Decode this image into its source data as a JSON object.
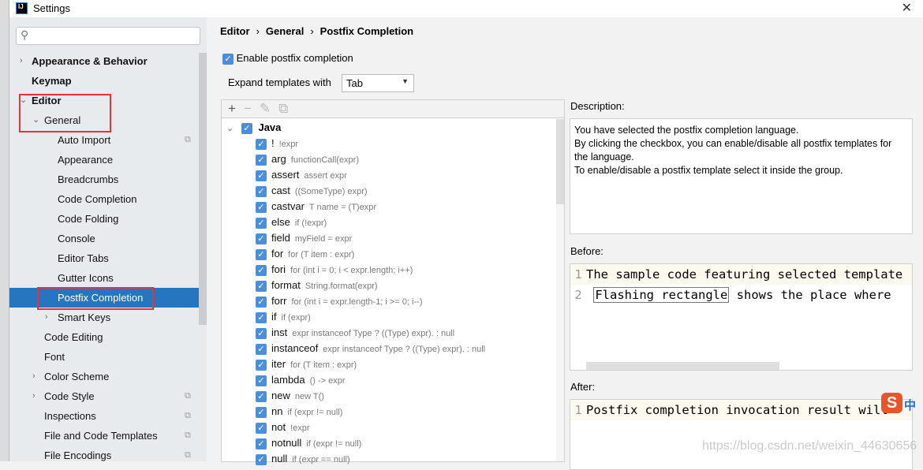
{
  "window": {
    "title": "Settings",
    "close": "✕"
  },
  "sidebar": {
    "search_placeholder": "",
    "items": [
      {
        "label": "Appearance & Behavior",
        "bold": true,
        "arrow": "›"
      },
      {
        "label": "Keymap",
        "bold": true
      },
      {
        "label": "Editor",
        "bold": true,
        "arrow": "⌄"
      },
      {
        "label": "General",
        "arrow": "⌄"
      },
      {
        "label": "Auto Import",
        "copy": true
      },
      {
        "label": "Appearance"
      },
      {
        "label": "Breadcrumbs"
      },
      {
        "label": "Code Completion"
      },
      {
        "label": "Code Folding"
      },
      {
        "label": "Console"
      },
      {
        "label": "Editor Tabs"
      },
      {
        "label": "Gutter Icons"
      },
      {
        "label": "Postfix Completion",
        "selected": true
      },
      {
        "label": "Smart Keys",
        "arrow": "›"
      },
      {
        "label": "Code Editing"
      },
      {
        "label": "Font"
      },
      {
        "label": "Color Scheme",
        "arrow": "›"
      },
      {
        "label": "Code Style",
        "arrow": "›",
        "copy": true
      },
      {
        "label": "Inspections",
        "copy": true
      },
      {
        "label": "File and Code Templates",
        "copy": true
      },
      {
        "label": "File Encodings",
        "copy": true
      }
    ]
  },
  "breadcrumb": [
    "Editor",
    "General",
    "Postfix Completion"
  ],
  "enable_postfix": {
    "label": "Enable postfix completion",
    "checked": true
  },
  "expand_templates": {
    "label": "Expand templates with",
    "value": "Tab"
  },
  "tree": {
    "group": "Java",
    "items": [
      [
        "!",
        "!expr"
      ],
      [
        "arg",
        "functionCall(expr)"
      ],
      [
        "assert",
        "assert expr"
      ],
      [
        "cast",
        "((SomeType) expr)"
      ],
      [
        "castvar",
        "T name = (T)expr"
      ],
      [
        "else",
        "if (!expr)"
      ],
      [
        "field",
        "myField = expr"
      ],
      [
        "for",
        "for (T item : expr)"
      ],
      [
        "fori",
        "for (int i = 0; i < expr.length; i++)"
      ],
      [
        "format",
        "String.format(expr)"
      ],
      [
        "forr",
        "for (int i = expr.length-1; i >= 0; i--)"
      ],
      [
        "if",
        "if (expr)"
      ],
      [
        "inst",
        "expr instanceof Type ? ((Type) expr). : null"
      ],
      [
        "instanceof",
        "expr instanceof Type ? ((Type) expr). : null"
      ],
      [
        "iter",
        "for (T item : expr)"
      ],
      [
        "lambda",
        "() -> expr"
      ],
      [
        "new",
        "new T()"
      ],
      [
        "nn",
        "if (expr != null)"
      ],
      [
        "not",
        "!expr"
      ],
      [
        "notnull",
        "if (expr != null)"
      ],
      [
        "null",
        "if (expr == null)"
      ]
    ]
  },
  "description": {
    "label": "Description:",
    "text": "You have selected the postfix completion language.\nBy clicking the checkbox, you can enable/disable all postfix templates for the language.\nTo enable/disable a postfix template select it inside the group."
  },
  "before": {
    "label": "Before:",
    "line1": "The sample code featuring selected template",
    "line2_flash": "Flashing rectangle",
    "line2_rest": " shows the place where"
  },
  "after": {
    "label": "After:",
    "line1": "Postfix completion invocation result will"
  },
  "watermark": "https://blog.csdn.net/weixin_44630656",
  "ime": {
    "logo": "S",
    "mode": "中"
  },
  "colors": {
    "selection": "#2675bf",
    "checkbox": "#4b8fdc",
    "highlight": "#e8323a"
  }
}
